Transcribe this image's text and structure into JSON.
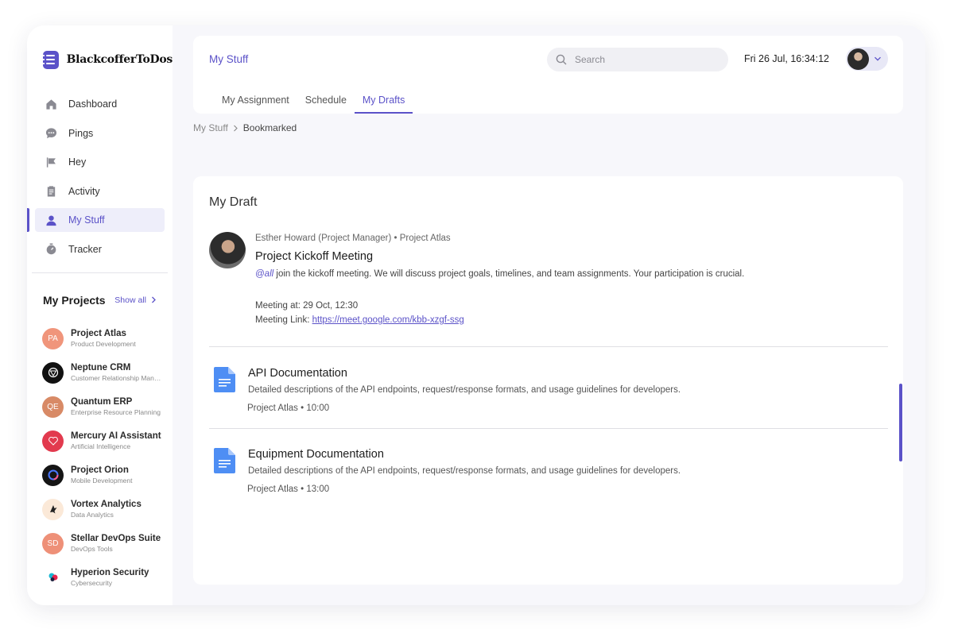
{
  "app": {
    "name": "BlackcofferToDos"
  },
  "sidebar": {
    "items": [
      {
        "label": "Dashboard",
        "icon": "home-icon"
      },
      {
        "label": "Pings",
        "icon": "chat-icon"
      },
      {
        "label": "Hey",
        "icon": "flag-icon"
      },
      {
        "label": "Activity",
        "icon": "clipboard-icon"
      },
      {
        "label": "My Stuff",
        "icon": "user-icon",
        "active": true
      },
      {
        "label": "Tracker",
        "icon": "stopwatch-icon"
      }
    ],
    "projects_title": "My Projects",
    "show_all": "Show all",
    "projects": [
      {
        "name": "Project Atlas",
        "sub": "Product Development",
        "initials": "PA",
        "color": "#f0957b"
      },
      {
        "name": "Neptune CRM",
        "sub": "Customer Relationship Management",
        "initials": "",
        "color": "#111111"
      },
      {
        "name": "Quantum ERP",
        "sub": "Enterprise Resource Planning",
        "initials": "QE",
        "color": "#d88a66"
      },
      {
        "name": "Mercury AI Assistant",
        "sub": "Artificial Intelligence",
        "initials": "",
        "color": "#e23a4e"
      },
      {
        "name": "Project Orion",
        "sub": "Mobile Development",
        "initials": "",
        "color": "#151515"
      },
      {
        "name": "Vortex Analytics",
        "sub": "Data Analytics",
        "initials": "",
        "color": "#fbe9d8"
      },
      {
        "name": "Stellar DevOps Suite",
        "sub": "DevOps Tools",
        "initials": "SD",
        "color": "#ee9078"
      },
      {
        "name": "Hyperion Security",
        "sub": "Cybersecurity",
        "initials": "",
        "color": "#ffffff"
      }
    ]
  },
  "header": {
    "title": "My Stuff",
    "search_placeholder": "Search",
    "datetime": "Fri 26 Jul, 16:34:12",
    "tabs": [
      {
        "label": "My Assignment"
      },
      {
        "label": "Schedule"
      },
      {
        "label": "My Drafts",
        "active": true
      }
    ]
  },
  "breadcrumb": {
    "parent": "My Stuff",
    "current": "Bookmarked"
  },
  "content": {
    "title": "My Draft",
    "post": {
      "author": "Esther Howard (Project Manager)",
      "project": "Project Atlas",
      "separator": "•",
      "title": "Project Kickoff Meeting",
      "mention": "@all",
      "text": " join the kickoff meeting. We will discuss project goals, timelines, and team assignments. Your participation is crucial.",
      "meeting_at_label": "Meeting at: ",
      "meeting_at": "29 Oct, 12:30",
      "meeting_link_label": "Meeting Link: ",
      "meeting_link": "https://meet.google.com/kbb-xzgf-ssg"
    },
    "docs": [
      {
        "title": "API Documentation",
        "desc": "Detailed descriptions of the API endpoints, request/response formats, and usage guidelines for developers.",
        "meta": "Project Atlas • 10:00"
      },
      {
        "title": "Equipment Documentation",
        "desc": "Detailed descriptions of the API endpoints, request/response formats, and usage guidelines for developers.",
        "meta": "Project Atlas • 13:00"
      }
    ]
  },
  "theme": {
    "accent": "#5b52c8"
  }
}
